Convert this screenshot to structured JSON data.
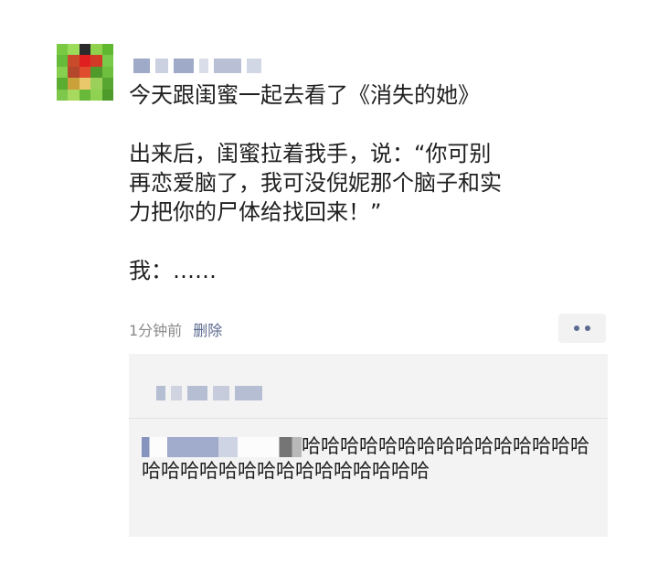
{
  "post": {
    "text": "今天跟闺蜜一起去看了《消失的她》\n\n出来后，闺蜜拉着我手，说：“你可别\n再恋爱脑了，我可没倪妮那个脑子和实\n力把你的尸体给找回来！”\n\n我：……",
    "time": "1分钟前",
    "delete_label": "删除"
  },
  "comment": {
    "text": "哈哈哈哈哈哈哈哈哈哈哈哈哈哈哈哈哈哈哈哈哈哈哈哈哈哈哈哈哈哈"
  },
  "colors": {
    "link": "#5b6a90",
    "meta": "#8a8a8a",
    "comment_bg": "#f3f3f3"
  }
}
